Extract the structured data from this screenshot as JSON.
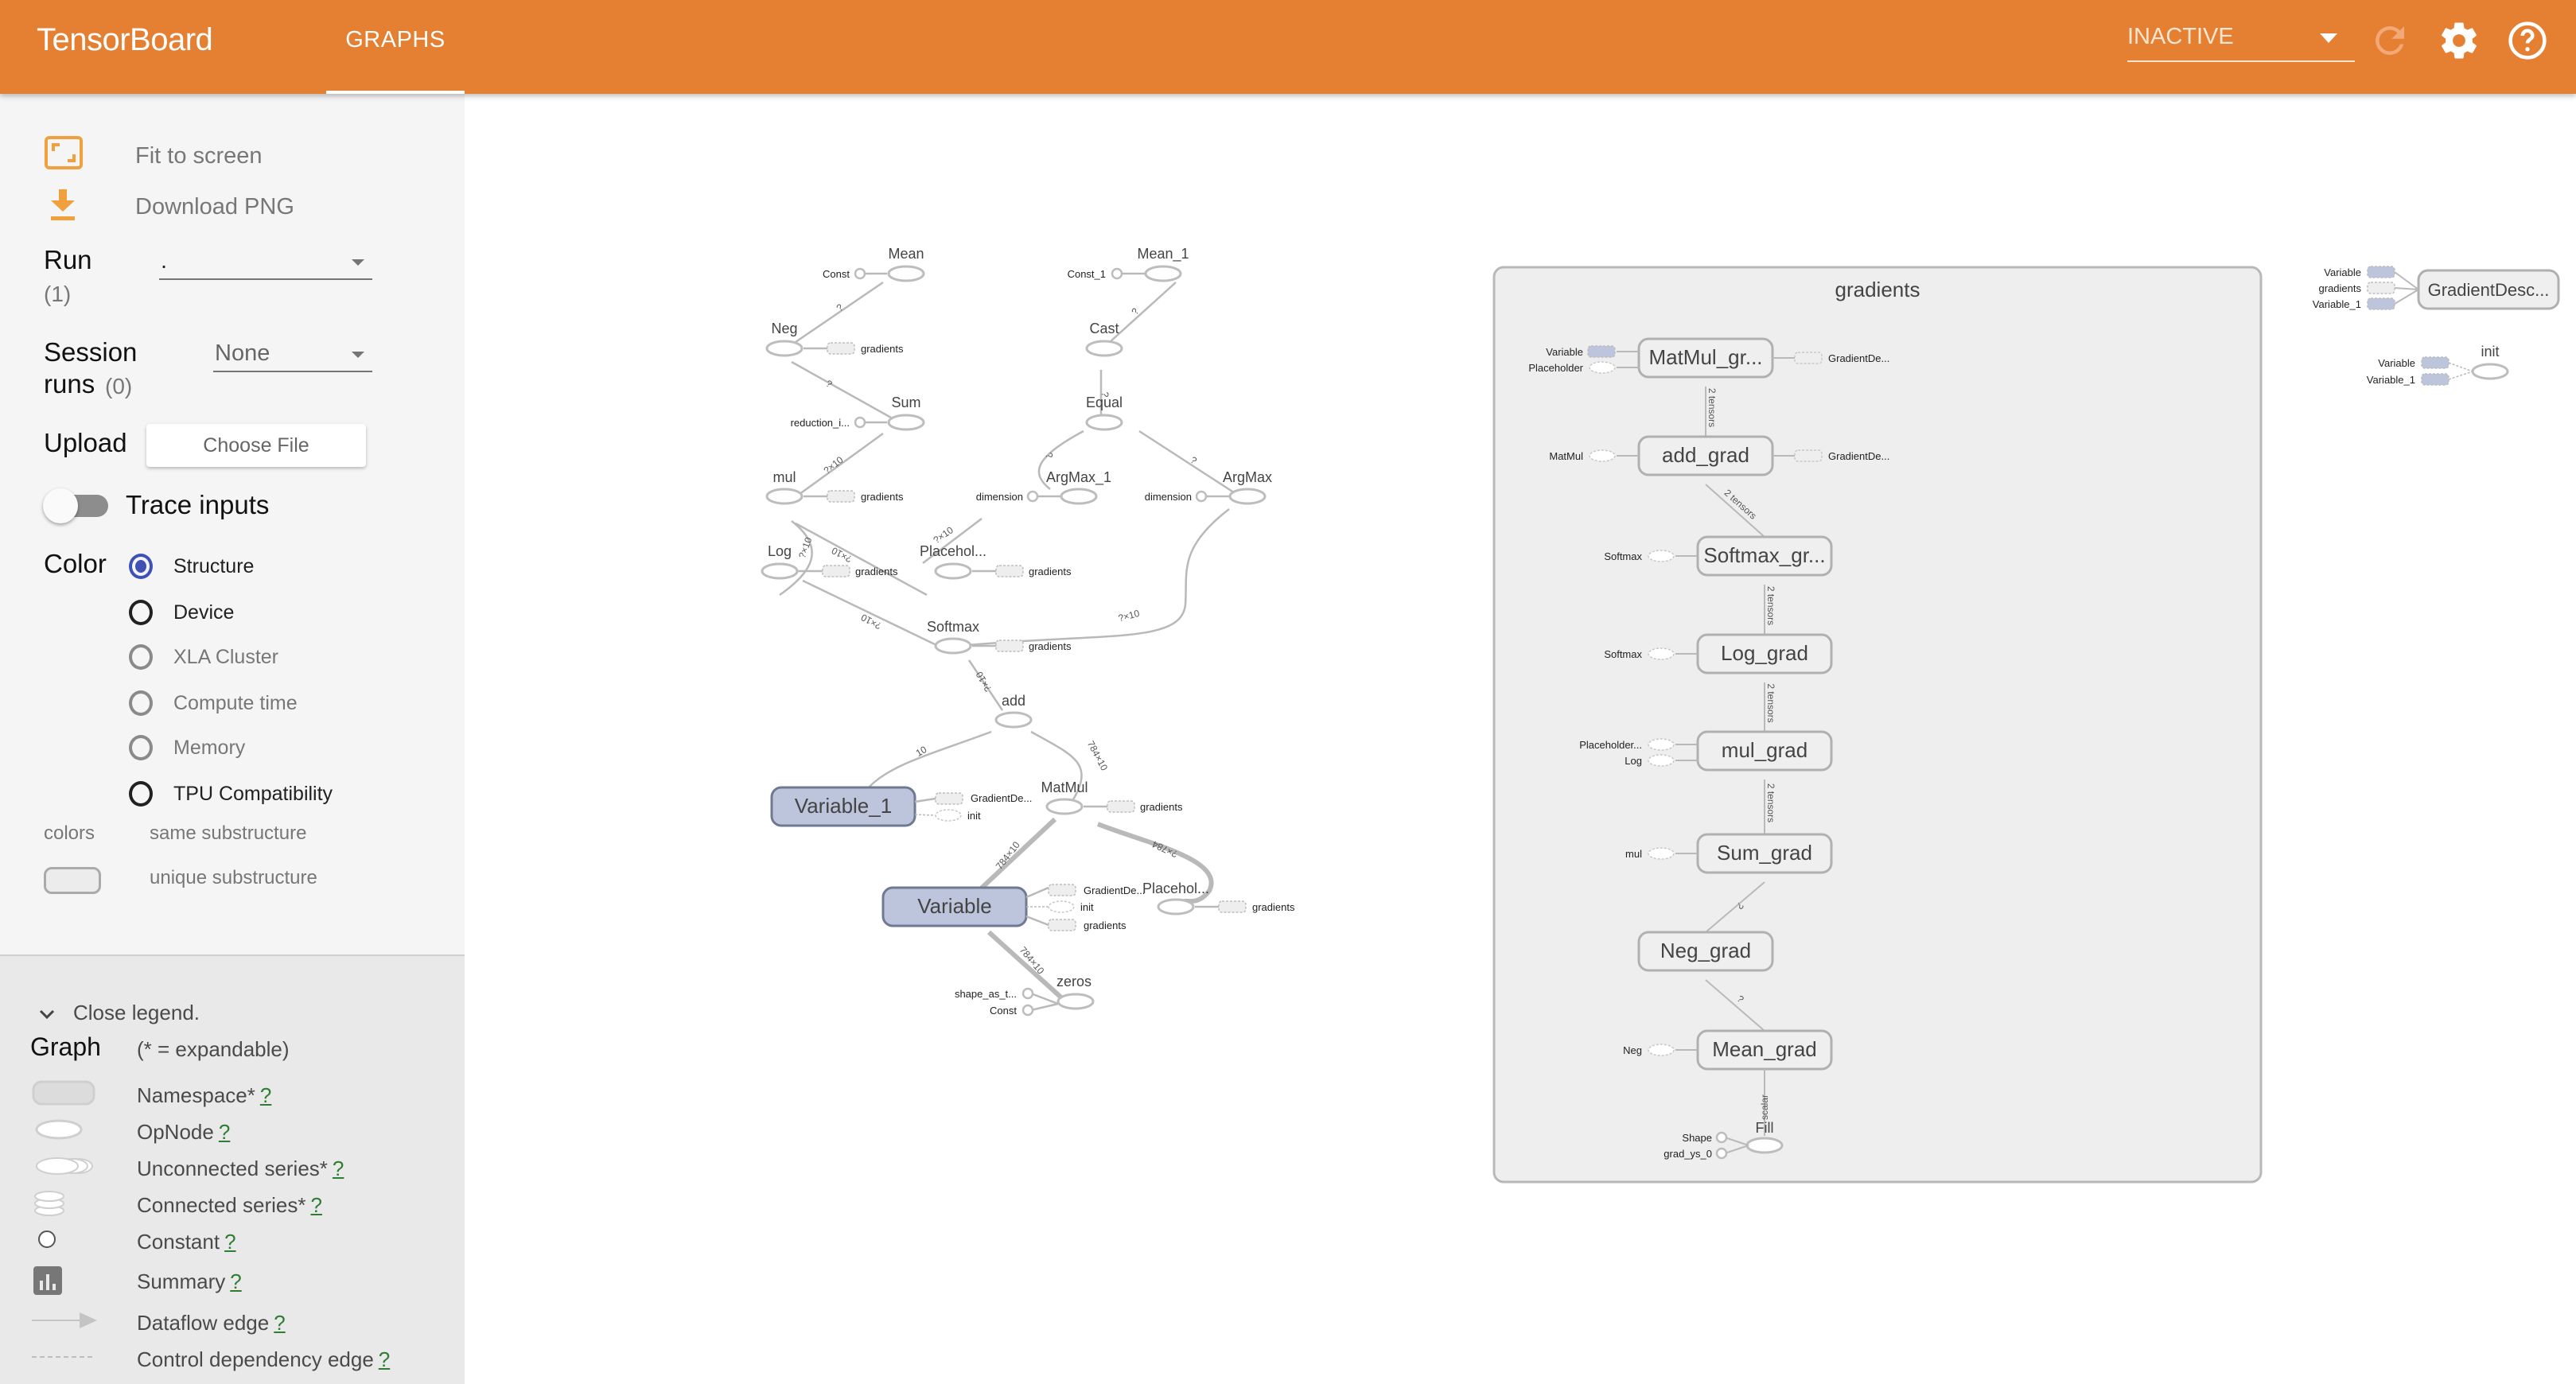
{
  "header": {
    "brand": "TensorBoard",
    "active_tab": "GRAPHS",
    "status_select": "INACTIVE",
    "icons": [
      "reload-icon",
      "settings-gear-icon",
      "help-icon"
    ]
  },
  "sidebar": {
    "fit_to_screen": "Fit to screen",
    "download_png": "Download PNG",
    "run_label": "Run",
    "run_count": "(1)",
    "run_value": ".",
    "session_label_line1": "Session",
    "session_label_line2": "runs",
    "session_count": "(0)",
    "session_value": "None",
    "upload_label": "Upload",
    "choose_file": "Choose File",
    "trace_inputs": "Trace inputs",
    "trace_inputs_on": false,
    "color_label": "Color",
    "color_options": [
      {
        "label": "Structure",
        "selected": true,
        "disabled": false
      },
      {
        "label": "Device",
        "selected": false,
        "disabled": false
      },
      {
        "label": "XLA Cluster",
        "selected": false,
        "disabled": true
      },
      {
        "label": "Compute time",
        "selected": false,
        "disabled": true
      },
      {
        "label": "Memory",
        "selected": false,
        "disabled": true
      },
      {
        "label": "TPU Compatibility",
        "selected": false,
        "disabled": false
      }
    ],
    "colors_label": "colors",
    "same_substructure": "same substructure",
    "unique_substructure": "unique substructure"
  },
  "legend": {
    "close": "Close legend.",
    "title": "Graph",
    "subtitle": "(* = expandable)",
    "help": "?",
    "items": [
      {
        "label": "Namespace*",
        "icon": "namespace-icon"
      },
      {
        "label": "OpNode",
        "icon": "opnode-icon"
      },
      {
        "label": "Unconnected series*",
        "icon": "unconnected-series-icon"
      },
      {
        "label": "Connected series*",
        "icon": "connected-series-icon"
      },
      {
        "label": "Constant",
        "icon": "constant-icon"
      },
      {
        "label": "Summary",
        "icon": "summary-icon"
      },
      {
        "label": "Dataflow edge",
        "icon": "dataflow-edge-icon"
      },
      {
        "label": "Control dependency edge",
        "icon": "control-edge-icon"
      }
    ]
  },
  "graph": {
    "main_nodes": [
      {
        "id": "Mean",
        "label": "Mean"
      },
      {
        "id": "Mean_1",
        "label": "Mean_1"
      },
      {
        "id": "Neg",
        "label": "Neg"
      },
      {
        "id": "Cast",
        "label": "Cast"
      },
      {
        "id": "Sum",
        "label": "Sum"
      },
      {
        "id": "Equal",
        "label": "Equal"
      },
      {
        "id": "mul",
        "label": "mul"
      },
      {
        "id": "ArgMax_1",
        "label": "ArgMax_1"
      },
      {
        "id": "ArgMax",
        "label": "ArgMax"
      },
      {
        "id": "Log",
        "label": "Log"
      },
      {
        "id": "Placeholder_1",
        "label": "Placehol..."
      },
      {
        "id": "Softmax",
        "label": "Softmax"
      },
      {
        "id": "add",
        "label": "add"
      },
      {
        "id": "MatMul",
        "label": "MatMul"
      },
      {
        "id": "Placeholder",
        "label": "Placehol..."
      },
      {
        "id": "zeros",
        "label": "zeros"
      },
      {
        "id": "Variable_1",
        "label": "Variable_1"
      },
      {
        "id": "Variable",
        "label": "Variable"
      }
    ],
    "constants": [
      {
        "id": "c_const",
        "label": "Const"
      },
      {
        "id": "c_const1",
        "label": "Const_1"
      },
      {
        "id": "c_red",
        "label": "reduction_i..."
      },
      {
        "id": "c_dim1",
        "label": "dimension"
      },
      {
        "id": "c_dim2",
        "label": "dimension"
      },
      {
        "id": "c_shape",
        "label": "shape_as_t..."
      },
      {
        "id": "c_zconst",
        "label": "Const"
      }
    ],
    "aux_labels": {
      "gradients": "gradients",
      "gradient_desc": "GradientDe...",
      "init": "init"
    },
    "edge_labels": [
      "?",
      "?",
      "?",
      "?",
      "?",
      "?",
      "?×10",
      "?×10",
      "?×10",
      "?×10",
      "?×10",
      "?×10",
      "?×10",
      "10",
      "784×10",
      "784×10",
      "?×784"
    ],
    "gradients_ns": {
      "title": "gradients",
      "nodes": [
        "MatMul_gr...",
        "add_grad",
        "Softmax_gr...",
        "Log_grad",
        "mul_grad",
        "Sum_grad",
        "Neg_grad",
        "Mean_grad"
      ],
      "fill_node": "Fill",
      "fill_inputs": [
        "Shape",
        "grad_ys_0"
      ],
      "inputs": {
        "MatMul_gr...": [
          "Variable",
          "Placeholder"
        ],
        "add_grad": [
          "MatMul"
        ],
        "Softmax_gr...": [
          "Softmax"
        ],
        "Log_grad": [
          "Softmax"
        ],
        "mul_grad": [
          "Placeholder...",
          "Log"
        ],
        "Sum_grad": [
          "mul"
        ],
        "Mean_grad": [
          "Neg"
        ]
      },
      "outputs": {
        "MatMul_gr...": "GradientDe...",
        "add_grad": "GradientDe..."
      },
      "edge_labels": [
        "2 tensors",
        "2 tensors",
        "2 tensors",
        "2 tensors",
        "2 tensors",
        "?",
        "?",
        "scalar"
      ]
    },
    "gradient_descent": {
      "label": "GradientDesc...",
      "inputs": [
        "Variable",
        "gradients",
        "Variable_1"
      ]
    },
    "init": {
      "label": "init",
      "inputs": [
        "Variable",
        "Variable_1"
      ]
    }
  },
  "colors": {
    "header": "#e57f31",
    "accent_orange": "#f0a03c",
    "radio_selected": "#3f51b5",
    "variable_fill": "#bcc5dc",
    "variable_stroke": "#6f7a92",
    "namespace_fill": "#eeeeee",
    "edge": "#b9b9b9"
  }
}
